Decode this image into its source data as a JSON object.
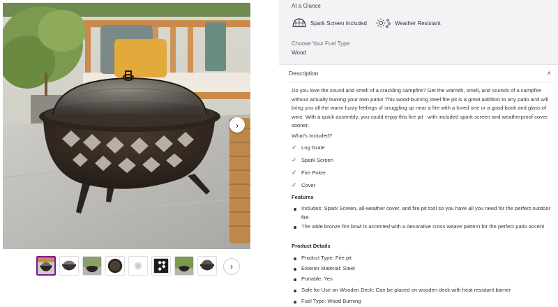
{
  "gallery": {
    "next_arrow": "›",
    "thumb_next": "›",
    "thumbnail_count": 8,
    "active_thumbnail": 0
  },
  "at_a_glance": {
    "title": "At a Glance",
    "features": [
      {
        "icon": "spark-screen-icon",
        "label": "Spark Screen Included"
      },
      {
        "icon": "weather-resistant-icon",
        "label": "Weather Resistant"
      }
    ],
    "fuel_label": "Choose Your Fuel Type",
    "fuel_value": "Wood"
  },
  "description": {
    "header": "Description",
    "collapse_icon": "chevron-up-icon",
    "collapse_glyph": "˄",
    "body": "Do you love the sound and smell of a crackling campfire? Get the warmth, smell, and sounds of a campfire without actually leaving your own patio! This wood-burning steel fire pit is a great addition to any patio and will bring you all the warm fuzzy feelings of snuggling up near a fire with a loved one or a good book and glass of wine. With a quick assembly, you could enjoy this fire pit - with included spark screen and weatherproof cover, sooner.",
    "included_title": "What's Included?",
    "included": [
      "Log Grate",
      "Spark Screen",
      "Fire Poker",
      "Cover"
    ],
    "check_glyph": "✓",
    "features_title": "Features",
    "features": [
      "Includes: Spark Screen, all-weather cover, and fire pit tool so you have all you need for the perfect outdoor fire",
      "The wide bronze fire bowl is accented with a decorative cross weave pattern for the perfect patio accent"
    ],
    "product_details_title": "Product Details",
    "product_details": [
      "Product Type: Fire pit",
      "Exterior Material: Steel",
      "Portable: Yes",
      "Safe for Use on Wooden Deck: Can be placed on wooden deck with heat resistant barrier",
      "Fuel Type: Wood Burning"
    ]
  },
  "colors": {
    "accent": "#7b189f",
    "panel_bg": "#f3f2f4",
    "text": "#3a3640"
  }
}
